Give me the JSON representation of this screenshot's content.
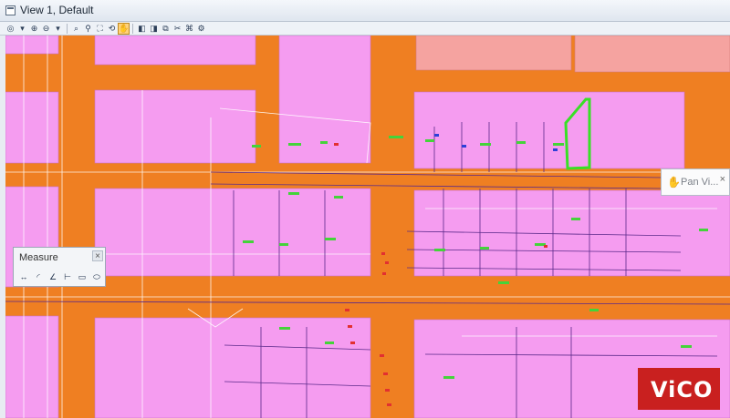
{
  "window": {
    "title": "View 1, Default"
  },
  "toolbar": {
    "icons": [
      "view-attributes-icon",
      "dropdown-icon",
      "zoom-in-icon",
      "zoom-out-icon",
      "dropdown-icon",
      "window-area-icon",
      "zoom-icon",
      "fit-view-icon",
      "rotate-icon",
      "pan-icon",
      "view-previous-icon",
      "view-next-icon",
      "copy-view-icon",
      "clip-icon",
      "camera-icon",
      "view-options-icon"
    ]
  },
  "measure_panel": {
    "title": "Measure",
    "close": "×"
  },
  "pan_tooltip": {
    "label": "Pan Vi..."
  },
  "logo": {
    "text": "ViCO"
  },
  "colors": {
    "road": "#ef7f22",
    "parcel": "#f59cf0",
    "parcel_salmon": "#f5a3a0",
    "highlight": "#38e026",
    "logo": "#c9201f"
  }
}
